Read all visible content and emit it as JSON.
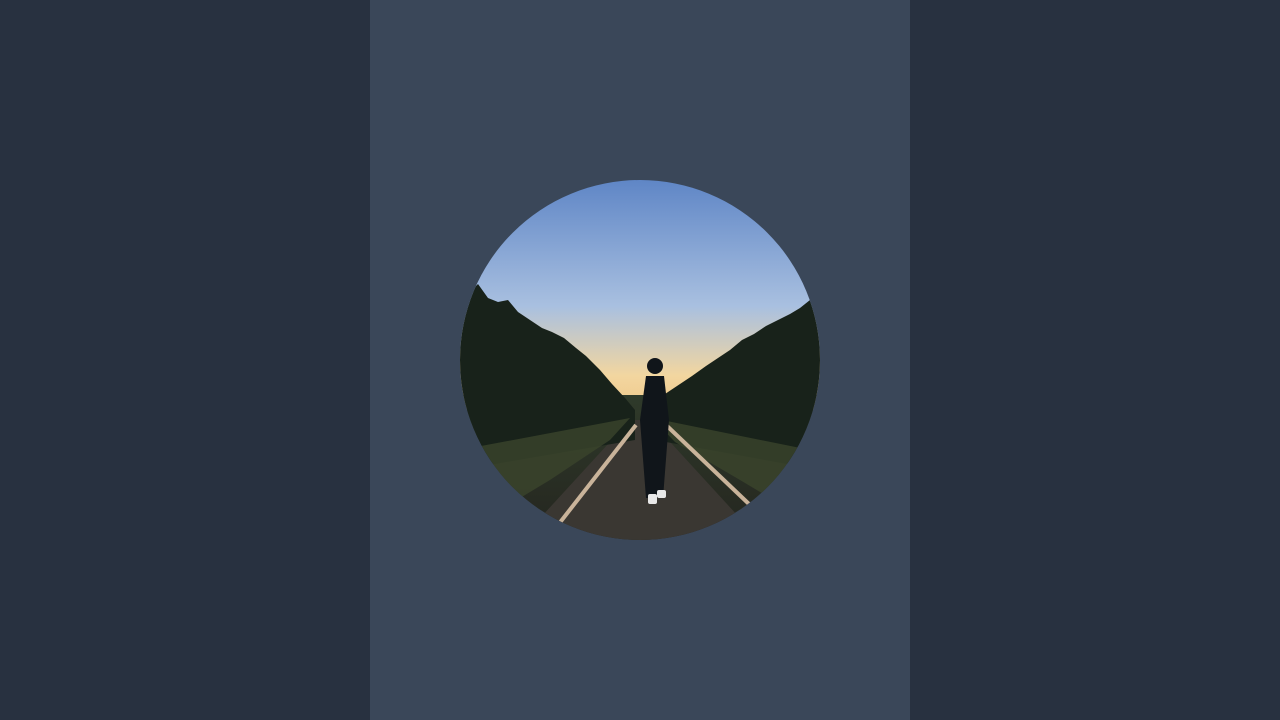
{
  "colors": {
    "page_background": "#283140",
    "center_panel": "#3a4759",
    "sky_top": "#5f86c6",
    "sky_mid": "#9bb7df",
    "sky_horizon": "#f2d6a0",
    "trees": "#1a2318",
    "ground": "#2b2d26",
    "rails": "#c9b39a",
    "figure": "#10151a",
    "shoes": "#e8e8e8"
  },
  "image": {
    "semantic": "profile-avatar-photo",
    "description_icon": "person-on-railroad-tracks"
  }
}
